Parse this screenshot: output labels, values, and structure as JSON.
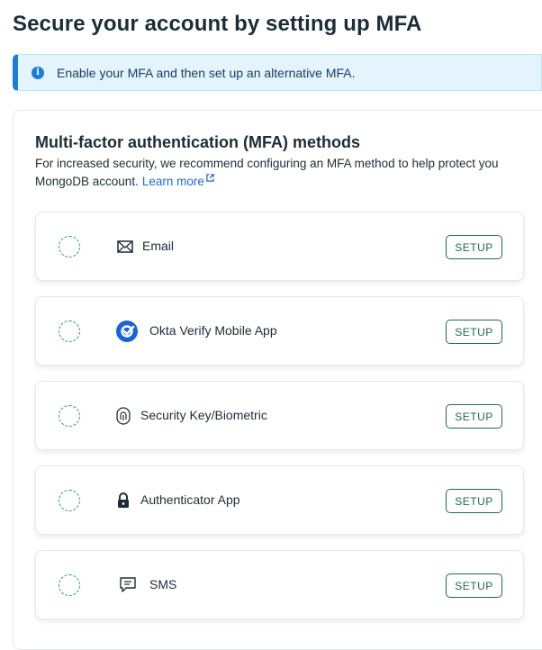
{
  "page": {
    "title": "Secure your account by setting up MFA"
  },
  "banner": {
    "icon": "info-icon",
    "text": "Enable your MFA and then set up an alternative MFA."
  },
  "section": {
    "title": "Multi-factor authentication (MFA) methods",
    "description": "For increased security, we recommend configuring an MFA method to help protect you MongoDB account.",
    "learn_more": "Learn more"
  },
  "methods": [
    {
      "icon": "envelope-icon",
      "label": "Email",
      "button": "SETUP"
    },
    {
      "icon": "okta-verify-icon",
      "label": "Okta Verify Mobile App",
      "button": "SETUP"
    },
    {
      "icon": "fingerprint-icon",
      "label": "Security Key/Biometric",
      "button": "SETUP"
    },
    {
      "icon": "lock-icon",
      "label": "Authenticator App",
      "button": "SETUP"
    },
    {
      "icon": "chat-bubble-icon",
      "label": "SMS",
      "button": "SETUP"
    }
  ],
  "colors": {
    "accent_green": "#1e6e46",
    "status_dashed_green": "#2e9b5c",
    "info_blue": "#1a7fd6",
    "banner_bg": "#e3f4fc",
    "link_blue": "#1a6cd1"
  }
}
